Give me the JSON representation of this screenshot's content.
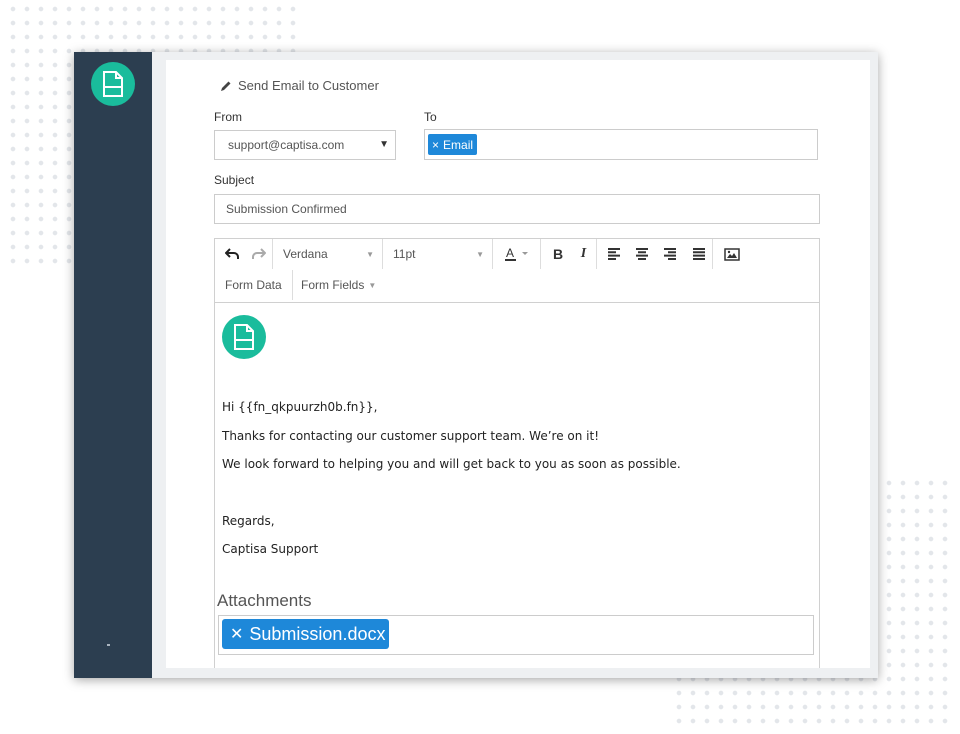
{
  "window": {
    "title": "Send Email to Customer"
  },
  "form": {
    "from_label": "From",
    "from_value": "support@captisa.com",
    "to_label": "To",
    "to_chip": "Email",
    "subject_label": "Subject",
    "subject_value": "Submission Confirmed"
  },
  "toolbar": {
    "font_family": "Verdana",
    "font_size": "11pt",
    "form_data_label": "Form Data",
    "form_fields_label": "Form Fields"
  },
  "email_body": {
    "greeting": "Hi {{fn_qkpuurzh0b.fn}},",
    "line1": "Thanks for contacting our customer support team. We’re on it!",
    "line2": "We look forward to helping you and will get back to you as soon as possible.",
    "sign_off": "Regards,",
    "signature": "Captisa Support"
  },
  "attachments": {
    "label": "Attachments",
    "file": "Submission.docx"
  },
  "colors": {
    "sidebar": "#2c3e50",
    "accent_teal": "#1abc9c",
    "chip_blue": "#1e88d9"
  },
  "icons": {
    "app": "document-icon",
    "title": "pencil-icon",
    "undo": "undo-icon",
    "redo": "redo-icon",
    "font_color": "font-color-icon",
    "bold": "bold-icon",
    "italic": "italic-icon",
    "align_left": "align-left-icon",
    "align_center": "align-center-icon",
    "align_right": "align-right-icon",
    "justify": "justify-icon",
    "image": "image-icon"
  }
}
